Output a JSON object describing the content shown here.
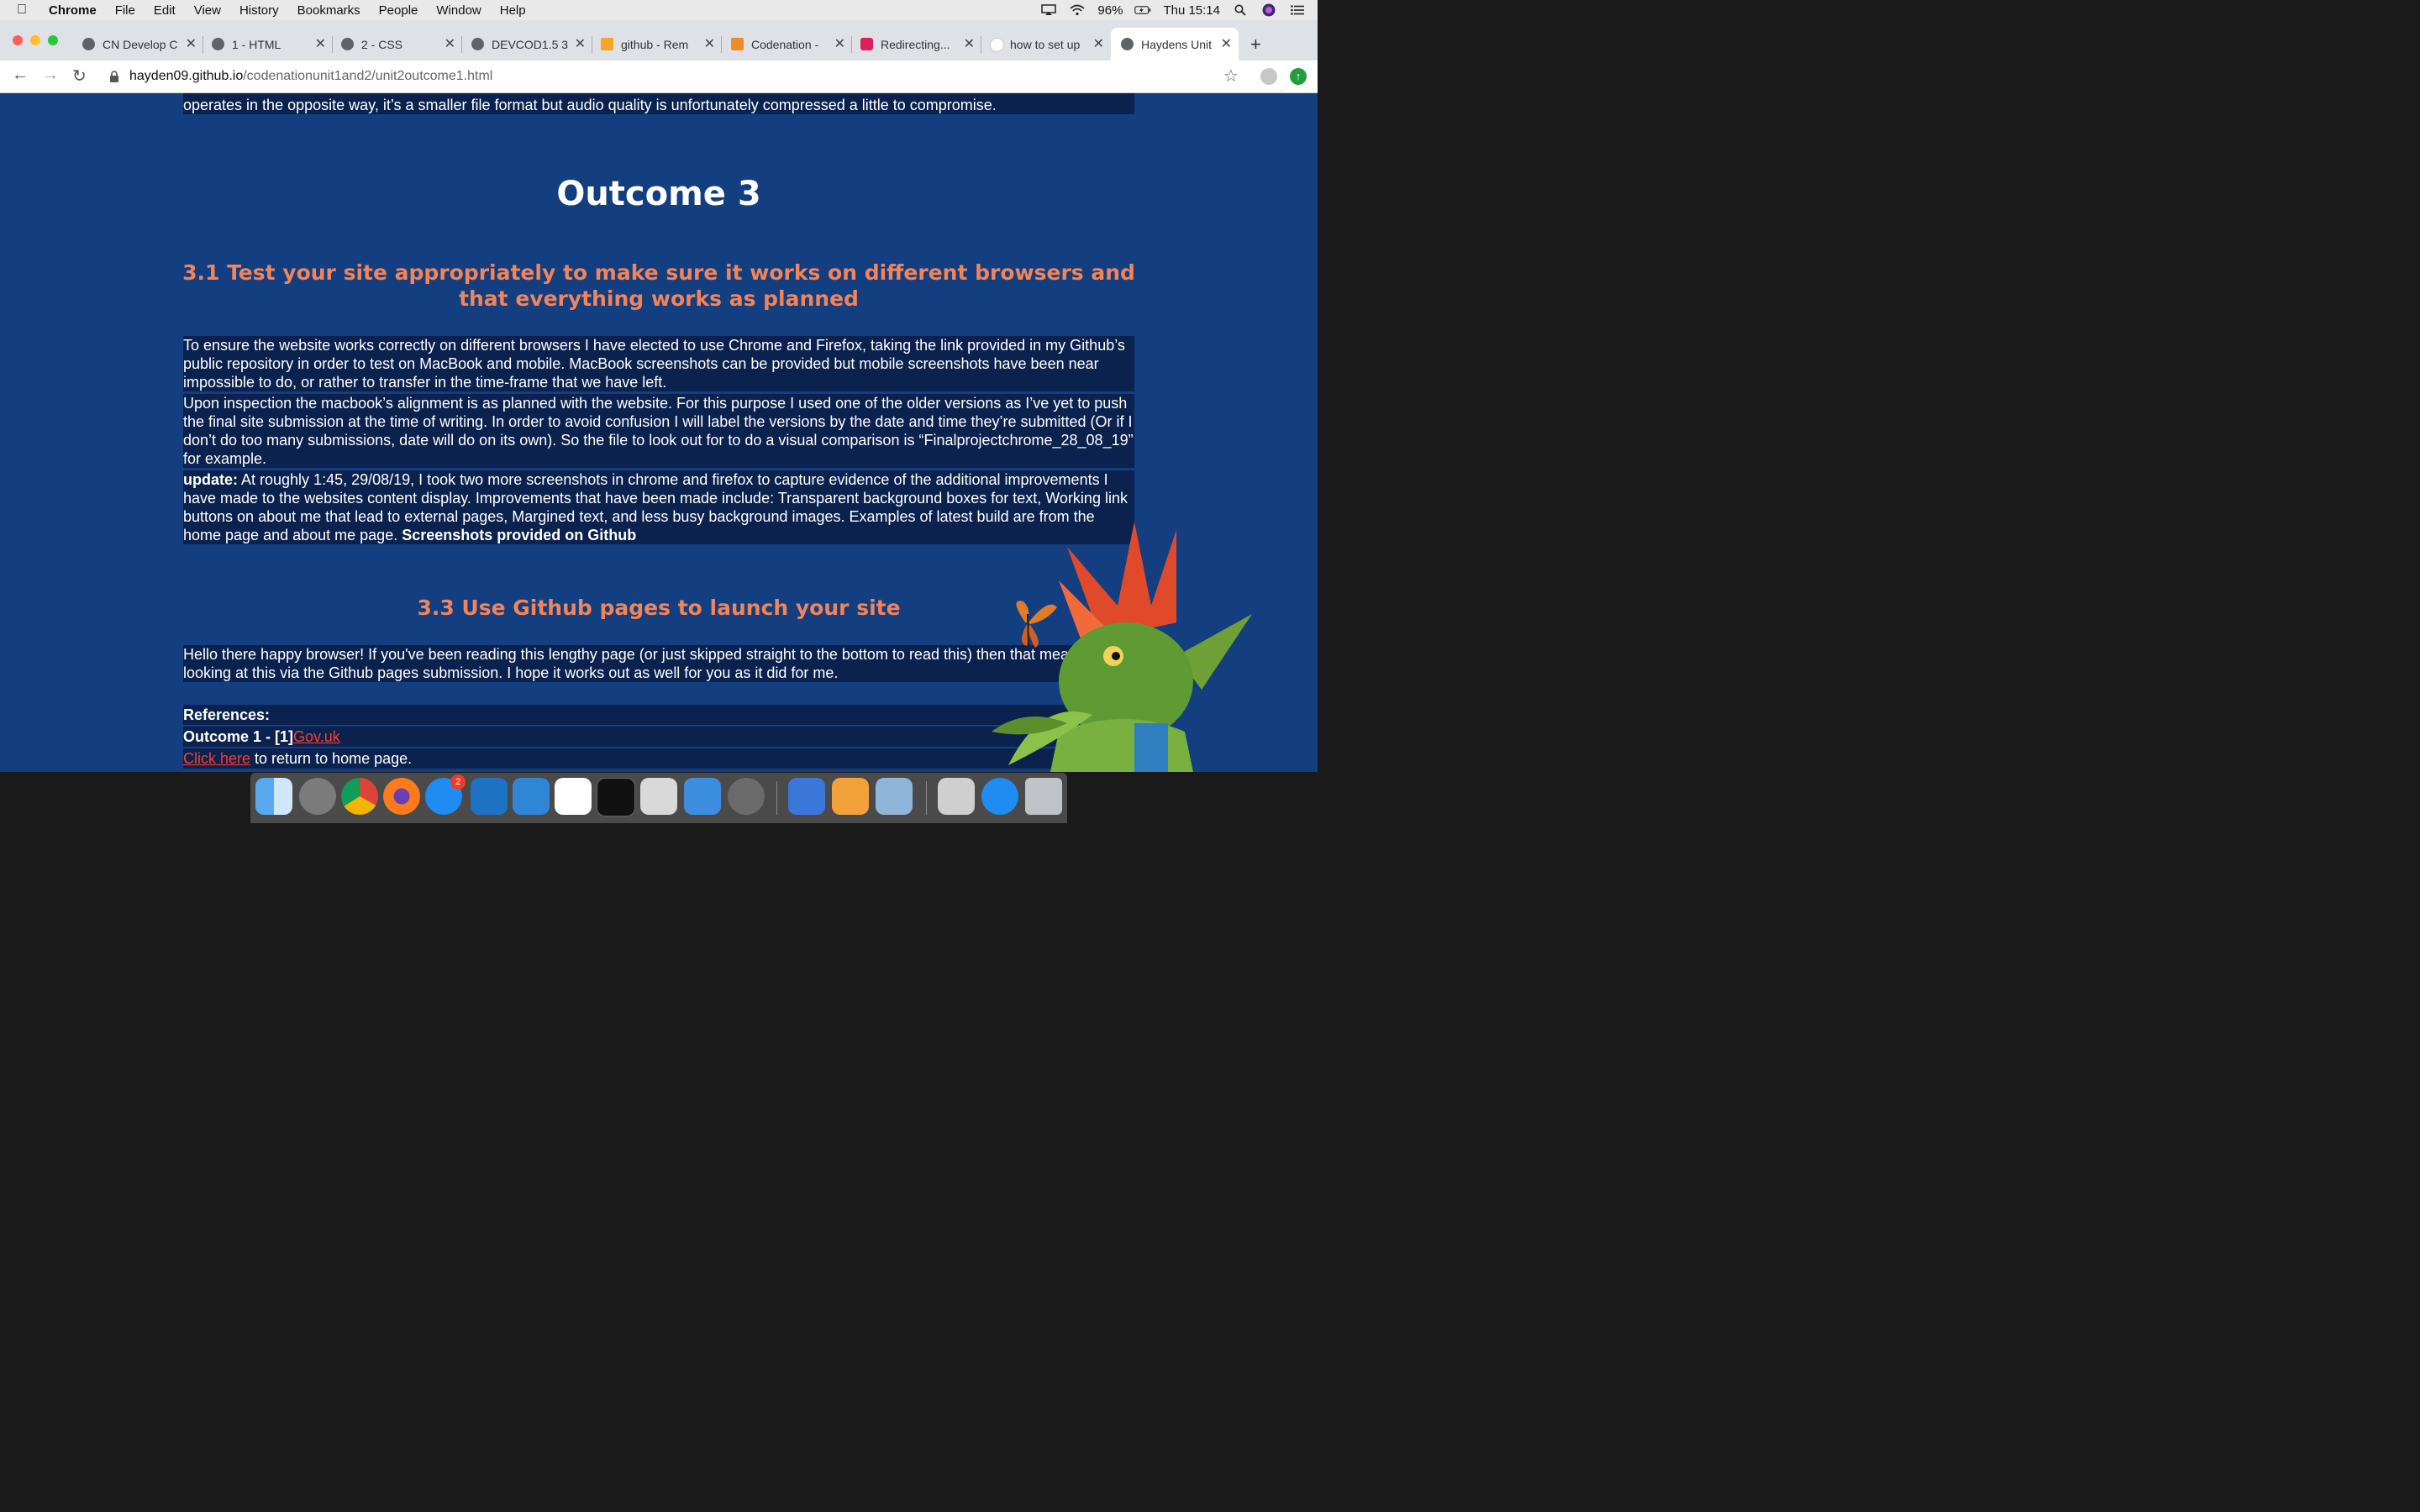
{
  "menubar": {
    "app": "Chrome",
    "items": [
      "File",
      "Edit",
      "View",
      "History",
      "Bookmarks",
      "People",
      "Window",
      "Help"
    ],
    "battery": "96%",
    "clock": "Thu 15:14"
  },
  "tabs": [
    {
      "label": "CN Develop C",
      "icon": "globe-icon"
    },
    {
      "label": "1 - HTML",
      "icon": "globe-icon"
    },
    {
      "label": "2 - CSS",
      "icon": "globe-icon"
    },
    {
      "label": "DEVCOD1.5 3",
      "icon": "globe-icon"
    },
    {
      "label": "github - Rem",
      "icon": "stackoverflow-icon"
    },
    {
      "label": "Codenation -",
      "icon": "codenation-icon"
    },
    {
      "label": "Redirecting...",
      "icon": "slack-icon"
    },
    {
      "label": "how to set up",
      "icon": "google-icon"
    },
    {
      "label": "Haydens Unit",
      "icon": "globe-icon",
      "active": true
    }
  ],
  "address": {
    "host": "hayden09.github.io",
    "path": "/codenationunit1and2/unit2outcome1.html"
  },
  "content": {
    "top_line": "operates in the opposite way, it’s a smaller file format but audio quality is unfortunately compressed a little to compromise.",
    "outcome_heading": "Outcome 3",
    "section_31_heading": "3.1 Test your site appropriately to make sure it works on different browsers and that everything works as planned",
    "para1": "To ensure the website works correctly on different browsers I have elected to use Chrome and Firefox, taking the link provided in my Github’s public repository in order to test on MacBook and mobile. MacBook screenshots can be provided but mobile screenshots have been near impossible to do, or rather to transfer in the time-frame that we have left.",
    "para2": "Upon inspection the macbook’s alignment is as planned with the website. For this purpose I used one of the older versions as I’ve yet to push the final site submission at the time of writing. In order to avoid confusion I will label the versions by the date and time they’re submitted (Or if I don’t do too many submissions, date will do on its own). So the file to look out for to do a visual comparison is “Finalprojectchrome_28_08_19” for example.",
    "para3_label": "update:",
    "para3": " At roughly 1:45, 29/08/19, I took two more screenshots in chrome and firefox to capture evidence of the additional improvements I have made to the websites content display. Improvements that have been made include: Transparent background boxes for text, Working link buttons on about me that lead to external pages, Margined text, and less busy background images. Examples of latest build are from the home page and about me page. ",
    "para3_bold_end": "Screenshots provided on Github",
    "section_33_heading": "3.3 Use Github pages to launch your site",
    "para4": "Hello there happy browser! If you've been reading this lengthy page (or just skipped straight to the bottom to read this) then that means you're looking at this via the Github pages submission. I hope it works out as well for you as it did for me.",
    "references_label": "References:",
    "ref1_label": "Outcome 1 - [1]",
    "ref1_link": "Gov.uk",
    "click_here": "Click here",
    "return_text": " to return to home page."
  },
  "dock": {
    "app_store_badge": "2",
    "icons": [
      "finder-icon",
      "launchpad-icon",
      "chrome-icon",
      "firefox-icon",
      "app-store-icon",
      "vscode-icon",
      "xcode-icon",
      "slack-icon",
      "terminal-icon",
      "screenshot-icon",
      "simulator-icon",
      "system-preferences-icon",
      "keynote-icon",
      "pages-icon",
      "preview-icon",
      "music-icon",
      "app-store-folder-icon",
      "trash-icon"
    ]
  },
  "colors": {
    "page_bg": "#133e80",
    "box_bg": "#0b224f",
    "heading_orange": "#f18459",
    "link_red": "#ff3b30"
  }
}
